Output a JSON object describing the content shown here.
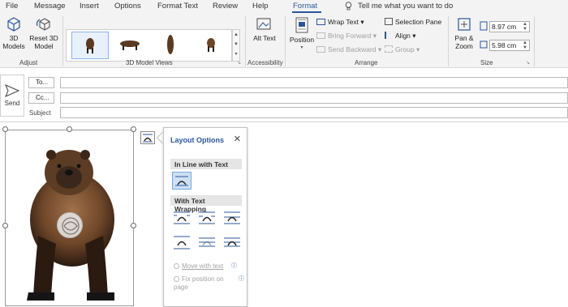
{
  "menubar": {
    "tabs": [
      {
        "label": "File"
      },
      {
        "label": "Message"
      },
      {
        "label": "Insert"
      },
      {
        "label": "Options"
      },
      {
        "label": "Format Text"
      },
      {
        "label": "Review"
      },
      {
        "label": "Help"
      },
      {
        "label": "Format"
      }
    ],
    "tell_me": "Tell me what you want to do"
  },
  "ribbon": {
    "adjust": {
      "btn1": "3D Models",
      "btn2": "Reset 3D Model",
      "label": "Adjust"
    },
    "views": {
      "label": "3D Model Views"
    },
    "accessibility": {
      "btn": "Alt Text",
      "label": "Accessibility"
    },
    "arrange": {
      "position": "Position",
      "wrap_text": "Wrap Text",
      "bring_forward": "Bring Forward",
      "send_backward": "Send Backward",
      "selection_pane": "Selection Pane",
      "align": "Align",
      "group": "Group",
      "label": "Arrange"
    },
    "size": {
      "pan_zoom": "Pan & Zoom",
      "height": "8.97 cm",
      "width": "5.98 cm",
      "label": "Size"
    }
  },
  "compose": {
    "send": "Send",
    "to": "To...",
    "cc": "Cc...",
    "subject": "Subject"
  },
  "layout_options": {
    "title": "Layout Options",
    "inline_header": "In Line with Text",
    "wrapping_header": "With Text Wrapping",
    "move_with_text": "Move with text",
    "fix_position": "Fix position on page"
  },
  "colors": {
    "accent": "#2b579a",
    "ribbon_bg": "#f3f3f3",
    "selected": "#cde0f4"
  }
}
